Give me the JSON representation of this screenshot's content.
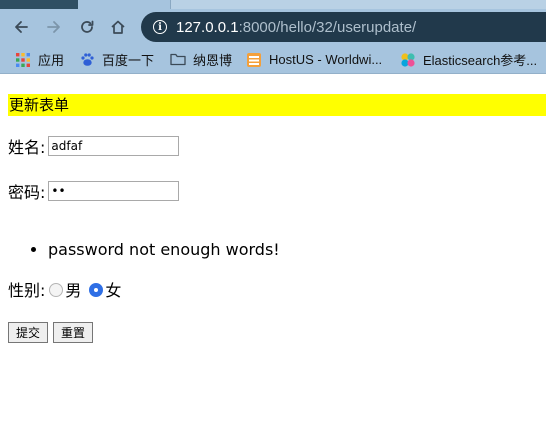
{
  "browser": {
    "url_host": "127.0.0.1",
    "url_path": ":8000/hello/32/userupdate/",
    "bookmarks": [
      {
        "label": "应用",
        "icon": "apps-grid-icon"
      },
      {
        "label": "百度一下",
        "icon": "baidu-paw-icon"
      },
      {
        "label": "纳恩博",
        "icon": "folder-icon"
      },
      {
        "label": "HostUS - Worldwi...",
        "icon": "hostus-server-icon"
      },
      {
        "label": "Elasticsearch参考...",
        "icon": "elasticsearch-icon"
      }
    ]
  },
  "form": {
    "title": "更新表单",
    "name_label": "姓名:",
    "name_value": "adfaf",
    "password_label": "密码:",
    "password_value": "ab",
    "errors": [
      "password not enough words!"
    ],
    "gender_label": "性别:",
    "gender_options": [
      {
        "label": "男",
        "selected": false
      },
      {
        "label": "女",
        "selected": true
      }
    ],
    "submit_label": "提交",
    "reset_label": "重置"
  },
  "colors": {
    "title_background": "#ffff00",
    "chrome_background": "#a6c4de",
    "omnibox_background": "#21394b",
    "radio_selected": "#2f6fe5"
  }
}
